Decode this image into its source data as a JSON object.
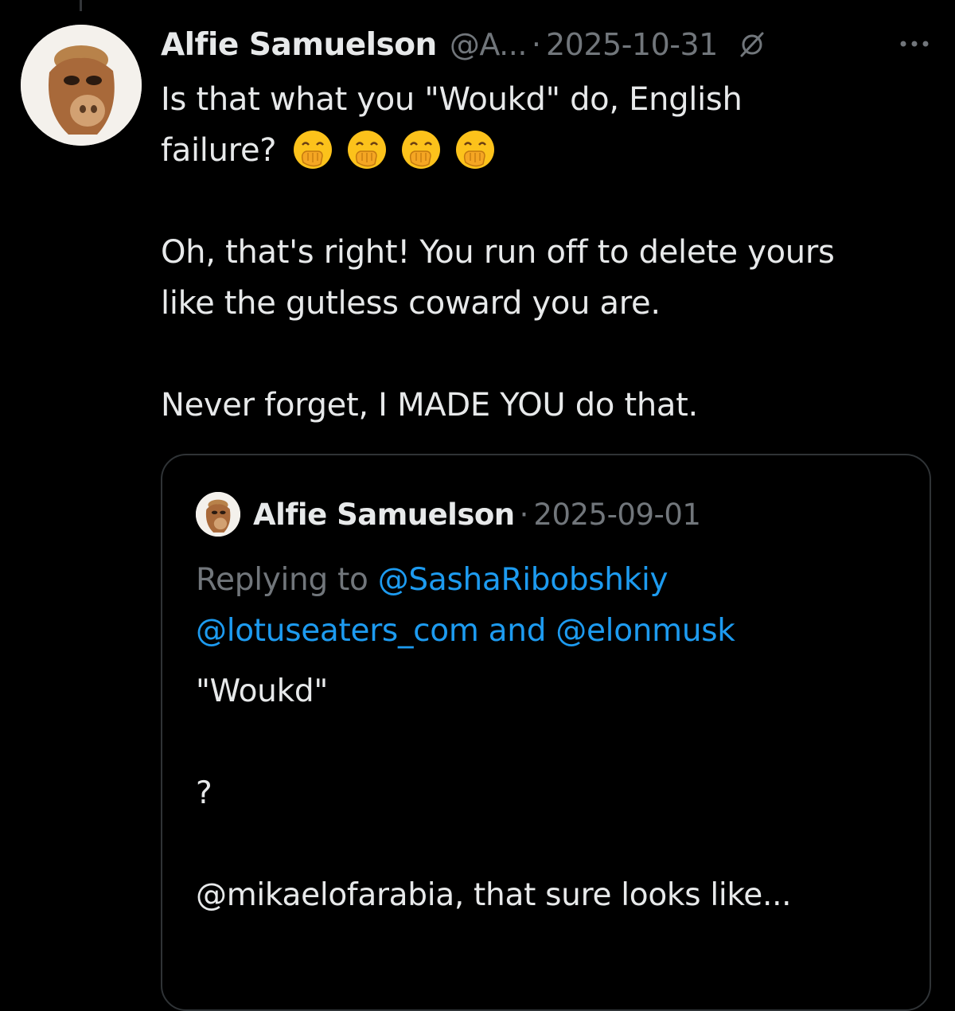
{
  "tweet": {
    "author_name": "Alfie Samuelson",
    "handle": "@A...",
    "separator": "·",
    "date": "2025-10-31",
    "line1": "Is that what you \"Woukd\" do, English",
    "line2": "failure?",
    "emoji_name": "face-with-hand-over-mouth-emoji",
    "paragraph2": "Oh, that's right! You run off to delete yours like the gutless coward you are.",
    "paragraph3": "Never forget, I MADE YOU do that."
  },
  "quote": {
    "author_name": "Alfie Samuelson",
    "separator": "·",
    "date": "2025-09-01",
    "replying_to_label": "Replying to",
    "mention1": "@SashaRibobshkiy",
    "mention2": "@lotuseaters_com",
    "and_label": "and",
    "mention3": "@elonmusk",
    "text1": "\"Woukd\"",
    "text2": "?",
    "text3": "@mikaelofarabia, that sure looks like..."
  },
  "colors": {
    "background": "#000000",
    "text": "#e7e9ea",
    "muted": "#71767b",
    "link": "#1d9bf0",
    "border": "#2f3336"
  },
  "icons": {
    "grok": "grok-slash-icon",
    "more": "more-dots-icon"
  }
}
